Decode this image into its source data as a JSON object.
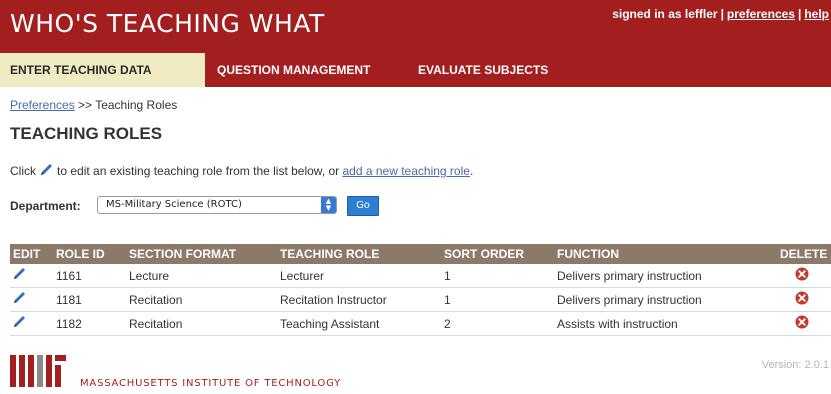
{
  "header": {
    "title": "WHO'S TEACHING WHAT",
    "signed_in_text": "signed in as leffler",
    "separator": "|",
    "preferences_link": "preferences",
    "help_link": "help",
    "brand_color": "#a31f1f"
  },
  "tabs": [
    {
      "label": "ENTER TEACHING DATA",
      "active": true
    },
    {
      "label": "QUESTION MANAGEMENT",
      "active": false
    },
    {
      "label": "EVALUATE SUBJECTS",
      "active": false
    }
  ],
  "breadcrumb": {
    "link": "Preferences",
    "separator": ">>",
    "current": "Teaching Roles"
  },
  "page": {
    "title": "TEACHING ROLES",
    "instructions_before": "Click",
    "instructions_middle": "to edit an existing teaching role from the list below, or",
    "add_link": "add a new teaching role",
    "instructions_end": "."
  },
  "department": {
    "label": "Department:",
    "selected": "MS-Military Science (ROTC)",
    "go_label": "Go"
  },
  "table": {
    "headers": [
      "EDIT",
      "ROLE ID",
      "SECTION FORMAT",
      "TEACHING ROLE",
      "SORT ORDER",
      "FUNCTION",
      "DELETE"
    ],
    "rows": [
      {
        "role_id": "1161",
        "section_format": "Lecture",
        "teaching_role": "Lecturer",
        "sort_order": "1",
        "function": "Delivers primary instruction"
      },
      {
        "role_id": "1181",
        "section_format": "Recitation",
        "teaching_role": "Recitation Instructor",
        "sort_order": "1",
        "function": "Delivers primary instruction"
      },
      {
        "role_id": "1182",
        "section_format": "Recitation",
        "teaching_role": "Teaching Assistant",
        "sort_order": "2",
        "function": "Assists with instruction"
      }
    ],
    "header_color": "#8b7a6a",
    "edit_icon": "pencil-icon",
    "delete_icon": "delete-x-icon"
  },
  "footer": {
    "logo": "mit-logo",
    "institute": "MASSACHUSETTS INSTITUTE OF TECHNOLOGY",
    "version": "Version: 2.0.1"
  }
}
